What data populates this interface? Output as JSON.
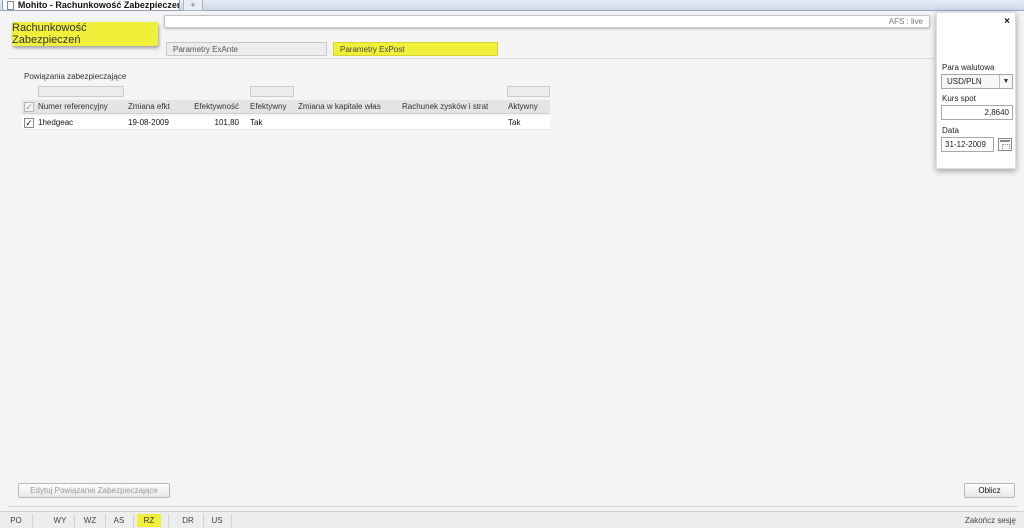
{
  "browser": {
    "tab_title": "Mohito - Rachunkowość Zabezpieczeń",
    "new_tab": "+"
  },
  "header": {
    "brand": "Rachunkowość Zabezpieczeń",
    "env_label": "AFS : live",
    "tabs": [
      {
        "label": "Parametry ExAnte",
        "active": false
      },
      {
        "label": "Parametry ExPost",
        "active": true
      }
    ]
  },
  "section": {
    "title": "Powiązania zabezpieczające"
  },
  "grid": {
    "columns": [
      "Numer referencyjny",
      "Zmiana efkt",
      "Efektywność",
      "Efektywny",
      "Zmiana w kapitale włas",
      "Rachunek zysków i strat",
      "Aktywny"
    ],
    "rows": [
      {
        "checked": true,
        "ref": "1hedgeac",
        "date": "19-08-2009",
        "effectiveness": "101,80",
        "effective": "Tak",
        "equity_change": "",
        "pnl": "",
        "active": "Tak"
      }
    ]
  },
  "panel": {
    "close": "×",
    "currency_pair_label": "Para walutowa",
    "currency_pair_value": "USD/PLN",
    "spot_label": "Kurs spot",
    "spot_value": "2,8640",
    "date_label": "Data",
    "date_value": "31-12-2009"
  },
  "buttons": {
    "edit": "Edytuj Powiązanie Zabezpieczające",
    "calculate": "Oblicz"
  },
  "statusbar": {
    "items": [
      {
        "label": "PO",
        "active": false
      },
      {
        "label": "WY",
        "active": false
      },
      {
        "label": "WZ",
        "active": false
      },
      {
        "label": "AS",
        "active": false
      },
      {
        "label": "RZ",
        "active": true
      },
      {
        "label": "DR",
        "active": false
      },
      {
        "label": "US",
        "active": false
      }
    ],
    "end_session": "Zakończ sesję"
  },
  "colors": {
    "accent_yellow": "#f0f03a"
  }
}
